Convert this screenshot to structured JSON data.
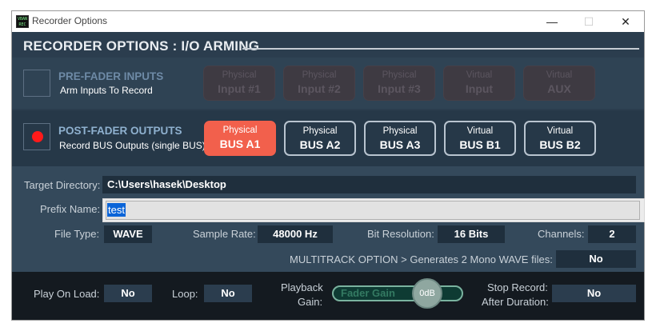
{
  "window": {
    "title": "Recorder Options",
    "minimize_glyph": "—",
    "maximize_glyph": "☐",
    "close_glyph": "✕",
    "app_icon": "vban-icon"
  },
  "header": {
    "title": "RECORDER OPTIONS : I/O ARMING"
  },
  "pre_fader": {
    "title": "PRE-FADER INPUTS",
    "subtitle": "Arm Inputs To Record",
    "checked": false,
    "buttons": [
      {
        "top": "Physical",
        "bottom": "Input #1"
      },
      {
        "top": "Physical",
        "bottom": "Input #2"
      },
      {
        "top": "Physical",
        "bottom": "Input #3"
      },
      {
        "top": "Virtual",
        "bottom": "Input"
      },
      {
        "top": "Virtual",
        "bottom": "AUX"
      }
    ]
  },
  "post_fader": {
    "title": "POST-FADER OUTPUTS",
    "subtitle": "Record BUS Outputs (single BUS)",
    "checked": true,
    "buttons": [
      {
        "top": "Physical",
        "bottom": "BUS A1",
        "state": "selected"
      },
      {
        "top": "Physical",
        "bottom": "BUS A2",
        "state": "idle"
      },
      {
        "top": "Physical",
        "bottom": "BUS A3",
        "state": "idle"
      },
      {
        "top": "Virtual",
        "bottom": "BUS B1",
        "state": "idle"
      },
      {
        "top": "Virtual",
        "bottom": "BUS B2",
        "state": "idle"
      }
    ]
  },
  "settings": {
    "target_dir_label": "Target Directory:",
    "target_dir_value": "C:\\Users\\hasek\\Desktop",
    "prefix_label": "Prefix Name:",
    "prefix_value": "test",
    "file_type_label": "File Type:",
    "file_type_value": "WAVE",
    "sample_rate_label": "Sample Rate:",
    "sample_rate_value": "48000 Hz",
    "bit_res_label": "Bit Resolution:",
    "bit_res_value": "16 Bits",
    "channels_label": "Channels:",
    "channels_value": "2",
    "multitrack_label": "MULTITRACK OPTION > Generates 2 Mono WAVE files:",
    "multitrack_value": "No"
  },
  "playback": {
    "play_on_load_label": "Play On Load:",
    "play_on_load_value": "No",
    "loop_label": "Loop:",
    "loop_value": "No",
    "gain_label_1": "Playback",
    "gain_label_2": "Gain:",
    "fader_label": "Fader Gain",
    "fader_value": "0dB",
    "stop_label_1": "Stop Record:",
    "stop_label_2": "After Duration:",
    "stop_value": "No"
  },
  "colors": {
    "panel": "#2b3d4e",
    "accent_selected": "#f2604c",
    "record_dot": "#ff1a1a",
    "pre_title": "#6e8aa6",
    "post_title": "#8fb1cf",
    "selection": "#0a64d8"
  }
}
